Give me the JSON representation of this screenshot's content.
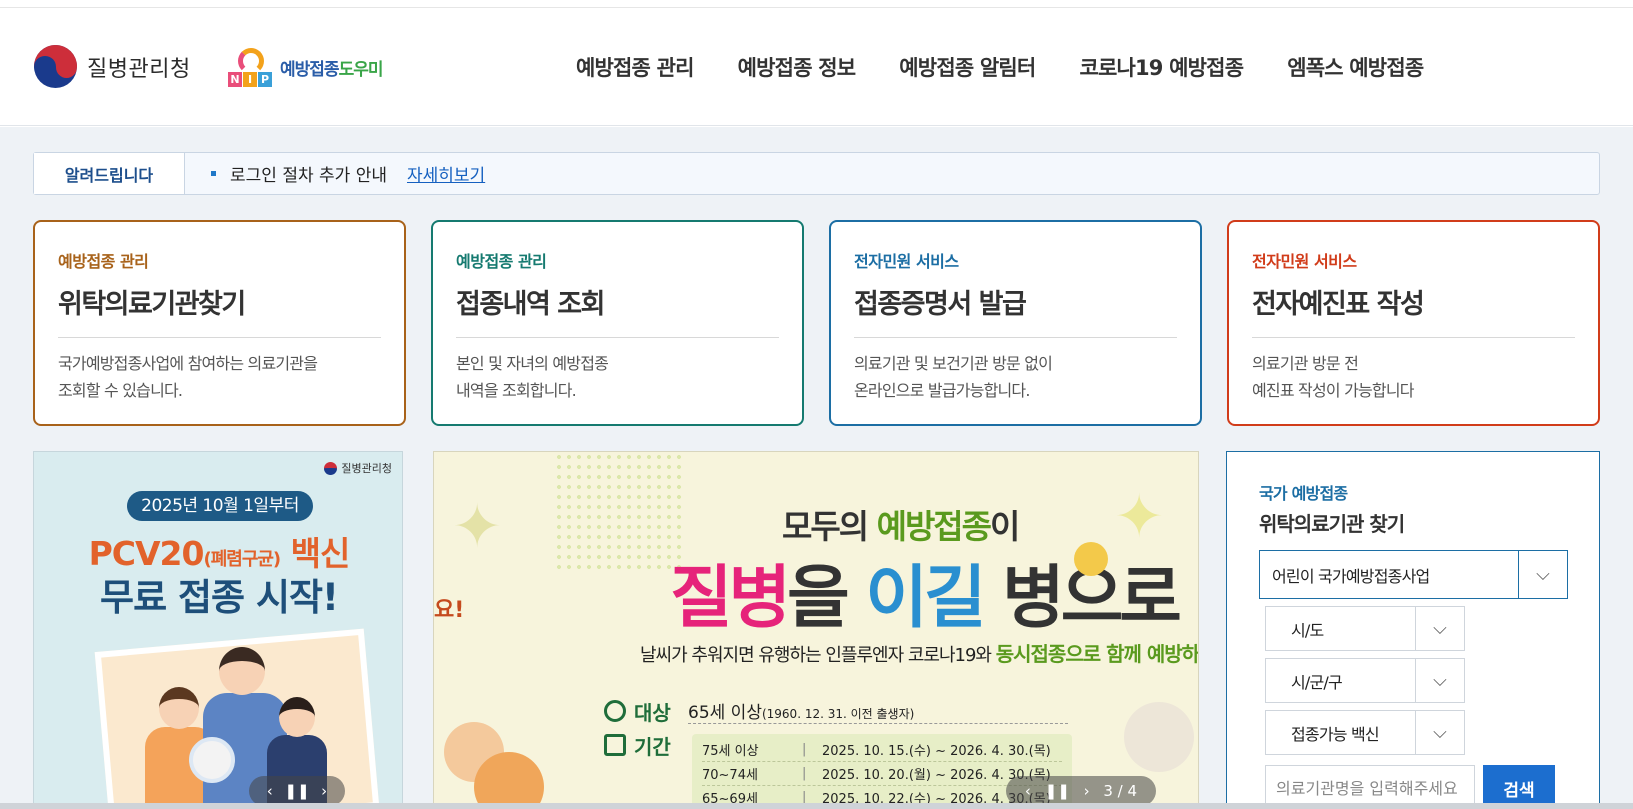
{
  "header": {
    "org_name": "질병관리청",
    "nip_logo_letters": [
      "N",
      "I",
      "P"
    ],
    "nip_logo_text_a": "예방접종",
    "nip_logo_text_b": "도우미",
    "nav": [
      {
        "label": "예방접종 관리"
      },
      {
        "label": "예방접종 정보"
      },
      {
        "label": "예방접종 알림터"
      },
      {
        "label": "코로나19 예방접종"
      },
      {
        "label": "엠폭스 예방접종"
      }
    ]
  },
  "notice": {
    "label": "알려드립니다",
    "text": "로그인 절차 추가 안내",
    "link": "자세히보기"
  },
  "cards": [
    {
      "category": "예방접종 관리",
      "title": "위탁의료기관찾기",
      "desc1": "국가예방접종사업에 참여하는 의료기관을",
      "desc2": "조회할 수 있습니다.",
      "color": "#a8621a"
    },
    {
      "category": "예방접종 관리",
      "title": "접종내역 조회",
      "desc1": "본인 및 자녀의 예방접종",
      "desc2": "내역을 조회합니다.",
      "color": "#157a70"
    },
    {
      "category": "전자민원 서비스",
      "title": "접종증명서 발급",
      "desc1": "의료기관 및 보건기관 방문 없이",
      "desc2": "온라인으로 발급가능합니다.",
      "color": "#1c6ea4"
    },
    {
      "category": "전자민원 서비스",
      "title": "전자예진표 작성",
      "desc1": "의료기관 방문 전",
      "desc2": "예진표 작성이 가능합니다",
      "color": "#d13c1a"
    }
  ],
  "banner1": {
    "org_label": "질병관리청",
    "date_pill": "2025년 10월 1일부터",
    "title_a": "PCV20",
    "title_paren": "(폐렴구균)",
    "title_b": " 백신",
    "title_line2": "무료 접종 시작!",
    "controls": {
      "prev": "‹",
      "pause": "❚❚",
      "next": "›"
    }
  },
  "banner2": {
    "headline_a": "모두의 ",
    "headline_green": "예방접종",
    "headline_b": "이",
    "big_a": "질병",
    "big_b": "을 ",
    "big_c": "이길",
    "big_d": " 병으로",
    "sub_a": "날씨가 추워지면 유행하는 인플루엔자 코로나19와 ",
    "sub_green": "동시접종으로 함께 예방하세",
    "side_text": "요!",
    "target_key": "대상",
    "target_val": "65세 이상",
    "target_note": "(1960. 12. 31. 이전 출생자)",
    "period_key": "기간",
    "rows": [
      {
        "age": "75세 이상",
        "period": "2025. 10. 15.(수) ~ 2026. 4. 30.(목)"
      },
      {
        "age": "70~74세",
        "period": "2025. 10. 20.(월) ~ 2026. 4. 30.(목)"
      },
      {
        "age": "65~69세",
        "period": "2025. 10. 22.(수) ~ 2026. 4. 30.(목)"
      }
    ],
    "separator": "|",
    "controls": {
      "prev": "‹",
      "pause": "❚❚",
      "next": "›",
      "counter": "3 / 4"
    }
  },
  "search_panel": {
    "category": "국가 예방접종",
    "title": "위탁의료기관 찾기",
    "program_select": "어린이 국가예방접종사업",
    "sido_select": "시/도",
    "sigungu_select": "시/군/구",
    "vaccine_select": "접종가능 백신",
    "input_placeholder": "의료기관명을 입력해주세요",
    "search_button": "검색",
    "arrow_glyph": "⌵"
  }
}
